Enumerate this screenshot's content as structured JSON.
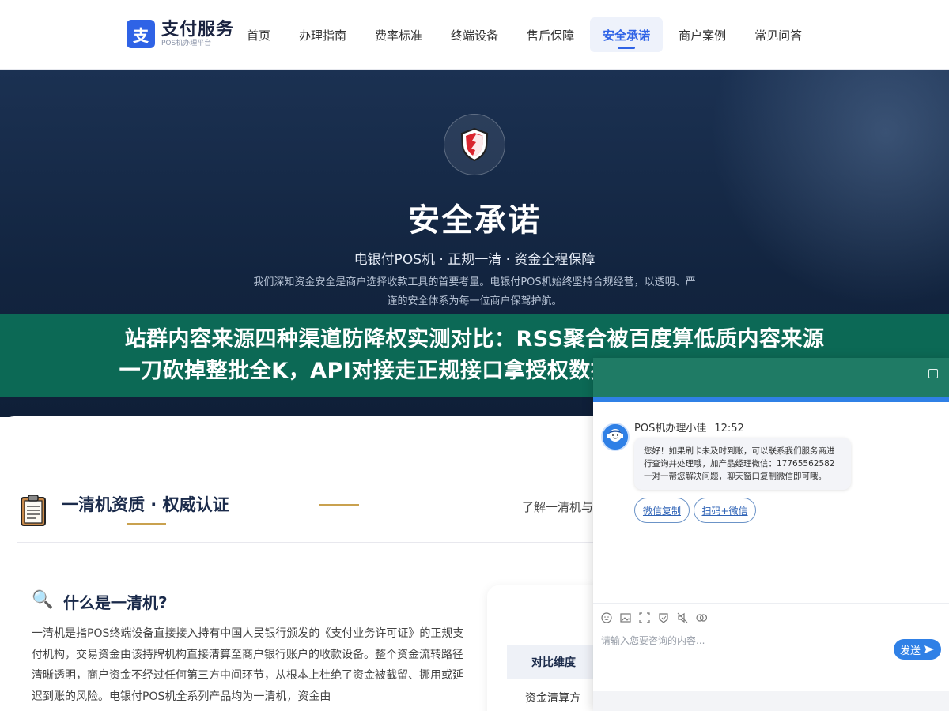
{
  "header": {
    "logo_mark": "支",
    "logo_title": "支付服务",
    "logo_subtitle": "POS机办理平台",
    "nav": [
      {
        "label": "首页",
        "active": false
      },
      {
        "label": "办理指南",
        "active": false
      },
      {
        "label": "费率标准",
        "active": false
      },
      {
        "label": "终端设备",
        "active": false
      },
      {
        "label": "售后保障",
        "active": false
      },
      {
        "label": "安全承诺",
        "active": true
      },
      {
        "label": "商户案例",
        "active": false
      },
      {
        "label": "常见问答",
        "active": false
      }
    ]
  },
  "hero": {
    "title": "安全承诺",
    "subtitle": "电银付POS机 · 正规一清 · 资金全程保障",
    "description": "我们深知资金安全是商户选择收款工具的首要考量。电银付POS机始终坚持合规经营，以透明、严谨的安全体系为每一位商户保驾护航。"
  },
  "banner": {
    "line1": "站群内容来源四种渠道防降权实测对比：RSS聚合被百度算低质内容来源",
    "line2": "一刀砍掉整批全K，API对接走正规接口拿授权数据最安全但覆盖范围有限"
  },
  "section": {
    "title": "一清机资质 · 权威认证",
    "more_text": "了解一清机与",
    "what_title": "什么是一清机?",
    "what_body": "一清机是指POS终端设备直接接入持有中国人民银行颁发的《支付业务许可证》的正规支付机构，交易资金由该持牌机构直接清算至商户银行账户的收款设备。整个资金流转路径清晰透明，商户资金不经过任何第三方中间环节，从根本上杜绝了资金被截留、挪用或延迟到账的风险。电银付POS机全系列产品均为一清机，资金由",
    "compare_head": "对比维度",
    "compare_row": "资金清算方"
  },
  "chat": {
    "agent_name": "POS机办理小佳",
    "time": "12:52",
    "message": "您好！如果刷卡未及时到账，可以联系我们服务商进行查询并处理哦，加产品经理微信：17765562582 一对一帮您解决问题，聊天窗口复制微信即可哦。",
    "buttons": [
      "微信复制",
      "扫码+微信"
    ],
    "input_placeholder": "请输入您要咨询的内容...",
    "send_label": "发送"
  },
  "colors": {
    "brand_blue": "#2f63e6",
    "hero_navy": "#12243f",
    "banner_green": "#0c7058",
    "gold": "#c9a14f"
  }
}
